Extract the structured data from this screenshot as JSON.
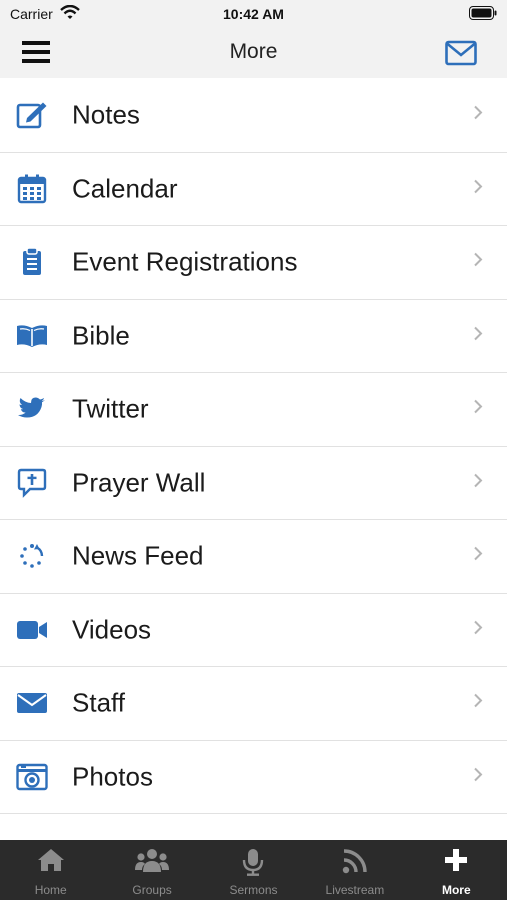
{
  "status_bar": {
    "carrier": "Carrier",
    "time": "10:42 AM"
  },
  "nav": {
    "title": "More"
  },
  "colors": {
    "accent": "#2e6fba",
    "tab_bar": "#2b2b2b",
    "tab_inactive": "#8c8c8c",
    "tab_active": "#ffffff"
  },
  "menu_items": [
    {
      "label": "Notes",
      "icon": "notes-icon"
    },
    {
      "label": "Calendar",
      "icon": "calendar-icon"
    },
    {
      "label": "Event Registrations",
      "icon": "clipboard-icon"
    },
    {
      "label": "Bible",
      "icon": "book-icon"
    },
    {
      "label": "Twitter",
      "icon": "twitter-icon"
    },
    {
      "label": "Prayer Wall",
      "icon": "prayer-icon"
    },
    {
      "label": "News Feed",
      "icon": "refresh-icon"
    },
    {
      "label": "Videos",
      "icon": "video-camera-icon"
    },
    {
      "label": "Staff",
      "icon": "envelope-icon"
    },
    {
      "label": "Photos",
      "icon": "camera-icon"
    }
  ],
  "tabs": [
    {
      "label": "Home",
      "icon": "home-icon",
      "active": false
    },
    {
      "label": "Groups",
      "icon": "groups-icon",
      "active": false
    },
    {
      "label": "Sermons",
      "icon": "microphone-icon",
      "active": false
    },
    {
      "label": "Livestream",
      "icon": "rss-icon",
      "active": false
    },
    {
      "label": "More",
      "icon": "plus-icon",
      "active": true
    }
  ]
}
